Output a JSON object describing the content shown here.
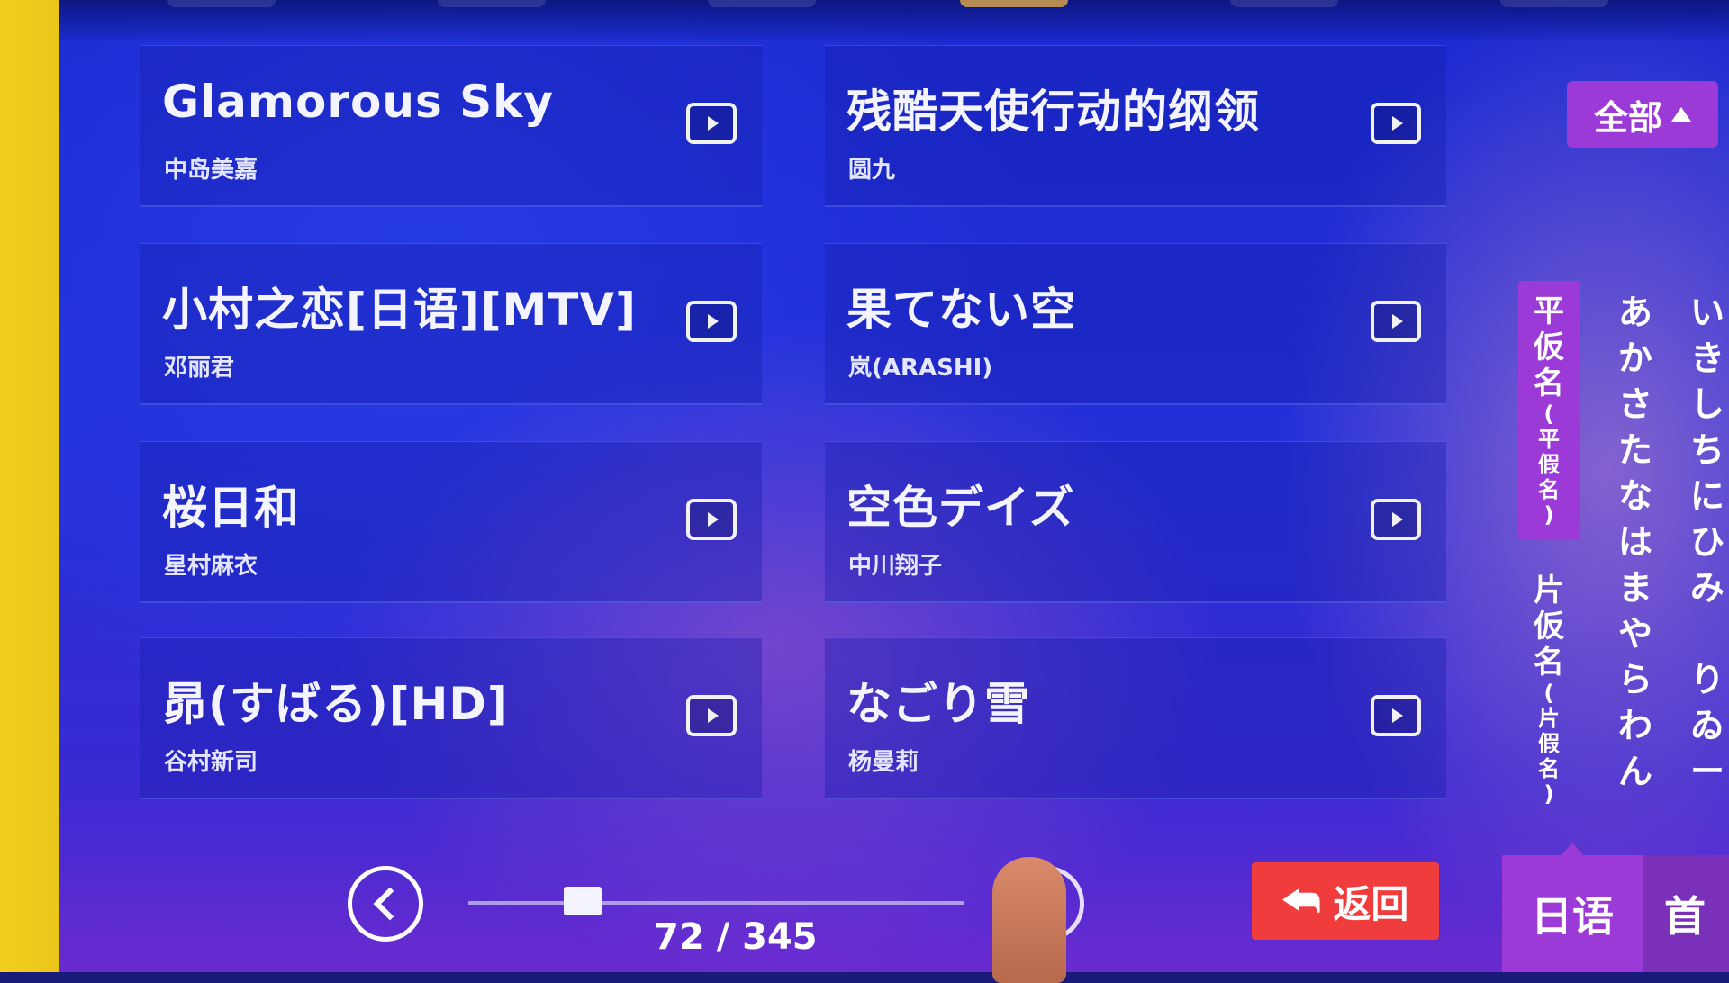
{
  "songs": [
    {
      "title": "Glamorous Sky",
      "artist": "中岛美嘉"
    },
    {
      "title": "残酷天使行动的纲领",
      "artist": "圆九"
    },
    {
      "title": "小村之恋[日语][MTV]",
      "artist": "邓丽君"
    },
    {
      "title": "果てない空",
      "artist": "岚(ARASHI)"
    },
    {
      "title": "桜日和",
      "artist": "星村麻衣"
    },
    {
      "title": "空色デイズ",
      "artist": "中川翔子"
    },
    {
      "title": "昴(すばる)[HD]",
      "artist": "谷村新司"
    },
    {
      "title": "なごり雪",
      "artist": "杨曼莉"
    }
  ],
  "filter": {
    "label": "全部"
  },
  "kana_tabs": {
    "hiragana": {
      "main": [
        "平",
        "仮",
        "名"
      ],
      "sub": [
        "(",
        "平",
        "假",
        "名",
        ")"
      ]
    },
    "katakana": {
      "main": [
        "片",
        "仮",
        "名"
      ],
      "sub": [
        "(",
        "片",
        "假",
        "名",
        ")"
      ]
    }
  },
  "kana_cols": {
    "col1": [
      "あ",
      "か",
      "さ",
      "た",
      "な",
      "は",
      "ま",
      "や",
      "ら",
      "わ",
      "ん"
    ],
    "col2": [
      "い",
      "き",
      "し",
      "ち",
      "に",
      "ひ",
      "み",
      "",
      "り",
      "ゐ",
      "ー"
    ]
  },
  "pager": {
    "current": 72,
    "total": 345,
    "text": "72 / 345",
    "progress": 0.21
  },
  "buttons": {
    "back": "返回",
    "language": "日语",
    "home": "首"
  },
  "colors": {
    "accent_purple": "#9b3ad6",
    "back_red": "#f03c3c",
    "screen_blue": "#2330d8"
  }
}
